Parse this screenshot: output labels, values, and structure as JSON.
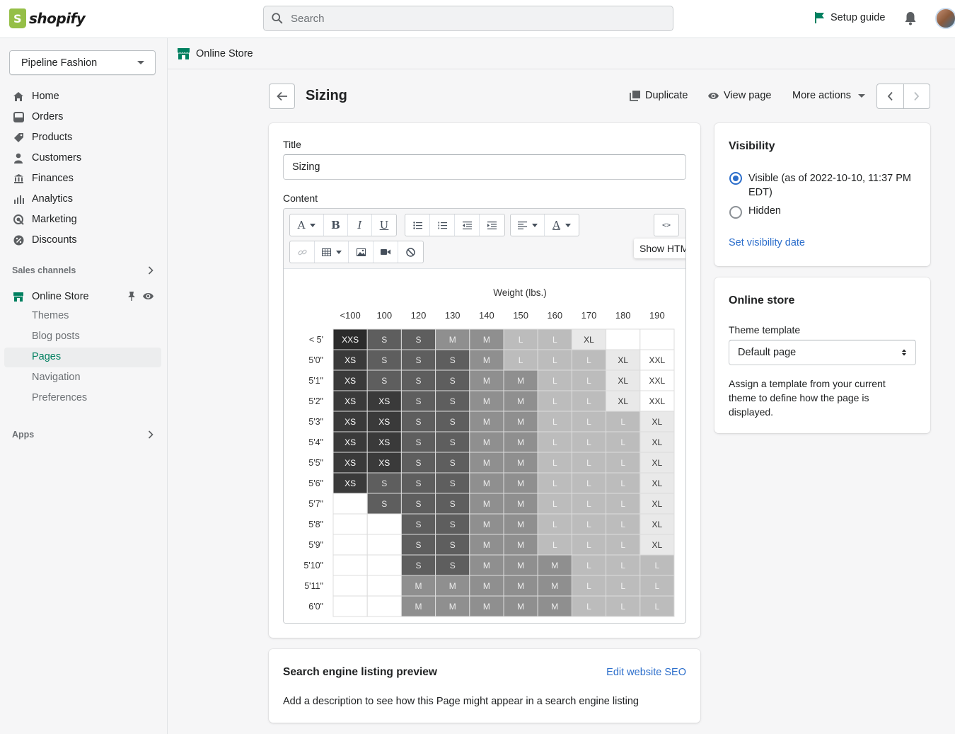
{
  "topbar": {
    "brand": "shopify",
    "search_placeholder": "Search",
    "setup_guide": "Setup guide"
  },
  "sidebar": {
    "store_name": "Pipeline Fashion",
    "nav": [
      "Home",
      "Orders",
      "Products",
      "Customers",
      "Finances",
      "Analytics",
      "Marketing",
      "Discounts"
    ],
    "sales_channels_label": "Sales channels",
    "online_store": "Online Store",
    "online_store_sub": [
      "Themes",
      "Blog posts",
      "Pages",
      "Navigation",
      "Preferences"
    ],
    "apps_label": "Apps"
  },
  "breadcrumb": {
    "current": "Online Store"
  },
  "header": {
    "title": "Sizing",
    "duplicate": "Duplicate",
    "view_page": "View page",
    "more_actions": "More actions"
  },
  "editor_card": {
    "title_label": "Title",
    "title_value": "Sizing",
    "content_label": "Content",
    "tooltip": "Show HTML",
    "html_btn": "<>"
  },
  "chart_data": {
    "type": "heatmap",
    "title": "Weight (lbs.)",
    "columns": [
      "<100",
      "100",
      "120",
      "130",
      "140",
      "150",
      "160",
      "170",
      "180",
      "190"
    ],
    "rows": [
      "< 5'",
      "5'0\"",
      "5'1\"",
      "5'2\"",
      "5'3\"",
      "5'4\"",
      "5'5\"",
      "5'6\"",
      "5'7\"",
      "5'8\"",
      "5'9\"",
      "5'10\"",
      "5'11\"",
      "6'0\""
    ],
    "cells": [
      [
        "XXS",
        "S",
        "S",
        "M",
        "M",
        "L",
        "L",
        "XL",
        "",
        ""
      ],
      [
        "XS",
        "S",
        "S",
        "S",
        "M",
        "L",
        "L",
        "L",
        "XL",
        "XXL"
      ],
      [
        "XS",
        "S",
        "S",
        "S",
        "M",
        "M",
        "L",
        "L",
        "XL",
        "XXL"
      ],
      [
        "XS",
        "XS",
        "S",
        "S",
        "M",
        "M",
        "L",
        "L",
        "XL",
        "XXL"
      ],
      [
        "XS",
        "XS",
        "S",
        "S",
        "M",
        "M",
        "L",
        "L",
        "L",
        "XL"
      ],
      [
        "XS",
        "XS",
        "S",
        "S",
        "M",
        "M",
        "L",
        "L",
        "L",
        "XL"
      ],
      [
        "XS",
        "XS",
        "S",
        "S",
        "M",
        "M",
        "L",
        "L",
        "L",
        "XL"
      ],
      [
        "XS",
        "S",
        "S",
        "S",
        "M",
        "M",
        "L",
        "L",
        "L",
        "XL"
      ],
      [
        "",
        "S",
        "S",
        "S",
        "M",
        "M",
        "L",
        "L",
        "L",
        "XL"
      ],
      [
        "",
        "",
        "S",
        "S",
        "M",
        "M",
        "L",
        "L",
        "L",
        "XL"
      ],
      [
        "",
        "",
        "S",
        "S",
        "M",
        "M",
        "L",
        "L",
        "L",
        "XL"
      ],
      [
        "",
        "",
        "S",
        "S",
        "M",
        "M",
        "M",
        "L",
        "L",
        "L"
      ],
      [
        "",
        "",
        "M",
        "M",
        "M",
        "M",
        "M",
        "L",
        "L",
        "L"
      ],
      [
        "",
        "",
        "M",
        "M",
        "M",
        "M",
        "M",
        "L",
        "L",
        "L"
      ]
    ],
    "size_colors": {
      "XXS": "#2b2b2b",
      "XS": "#3a3a3a",
      "S": "#5e5e5e",
      "M": "#8f8f8f",
      "L": "#bcbcbc",
      "XL": "#e9e9e9",
      "XXL": "#ffffff",
      "": "#ffffff"
    },
    "text_colors": {
      "XXS": "#ffffff",
      "XS": "#ffffff",
      "S": "#e6e6e6",
      "M": "#ececec",
      "L": "#f2f2f2",
      "XL": "#333333",
      "XXL": "#333333",
      "": "#333333"
    }
  },
  "seo_card": {
    "title": "Search engine listing preview",
    "edit_link": "Edit website SEO",
    "description": "Add a description to see how this Page might appear in a search engine listing"
  },
  "visibility_card": {
    "title": "Visibility",
    "visible_label": "Visible (as of 2022-10-10, 11:37 PM EDT)",
    "hidden_label": "Hidden",
    "set_date_link": "Set visibility date",
    "selected": "visible"
  },
  "online_store_card": {
    "title": "Online store",
    "theme_template_label": "Theme template",
    "theme_template_value": "Default page",
    "help_text": "Assign a template from your current theme to define how the page is displayed."
  }
}
